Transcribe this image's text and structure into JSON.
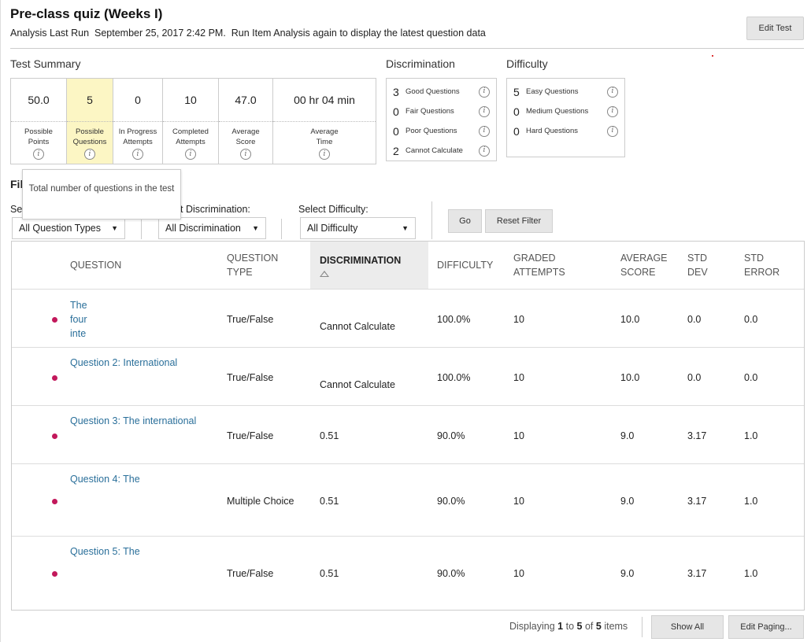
{
  "header": {
    "title": "Pre-class quiz (Weeks I)",
    "analysis_prefix": "Analysis Last Run",
    "analysis_date": "September 25, 2017 2:42 PM.",
    "analysis_suffix": "Run Item Analysis again to display the latest question data",
    "edit_test_label": "Edit Test"
  },
  "summary": {
    "label": "Test Summary",
    "items": [
      {
        "value": "50.0",
        "label1": "Possible",
        "label2": "Points"
      },
      {
        "value": "5",
        "label1": "Possible",
        "label2": "Questions"
      },
      {
        "value": "0",
        "label1": "In Progress",
        "label2": "Attempts"
      },
      {
        "value": "10",
        "label1": "Completed",
        "label2": "Attempts"
      },
      {
        "value": "47.0",
        "label1": "Average",
        "label2": "Score"
      },
      {
        "value": "00 hr 04 min",
        "label1": "Average",
        "label2": "Time"
      }
    ]
  },
  "discrimination": {
    "label": "Discrimination",
    "rows": [
      {
        "count": "3",
        "text": "Good Questions"
      },
      {
        "count": "0",
        "text": "Fair Questions"
      },
      {
        "count": "0",
        "text": "Poor Questions"
      },
      {
        "count": "2",
        "text": "Cannot Calculate"
      }
    ]
  },
  "difficulty": {
    "label": "Difficulty",
    "rows": [
      {
        "count": "5",
        "text": "Easy Questions"
      },
      {
        "count": "0",
        "text": "Medium Questions"
      },
      {
        "count": "0",
        "text": "Hard Questions"
      }
    ]
  },
  "tooltip": {
    "text": "Total number of questions in the test"
  },
  "filter": {
    "heading_partial": "Fil",
    "type_label_partial": "Se",
    "discrimination_label_partial": "t Discrimination:",
    "difficulty_label": "Select Difficulty:",
    "type_value": "All Question Types",
    "discrimination_value": "All Discrimination",
    "difficulty_value": "All Difficulty",
    "go_label": "Go",
    "reset_label": "Reset Filter"
  },
  "table": {
    "headers": {
      "question": "QUESTION",
      "type_1": "QUESTION",
      "type_2": "TYPE",
      "discrimination": "DISCRIMINATION",
      "difficulty": "DIFFICULTY",
      "graded_1": "GRADED",
      "graded_2": "ATTEMPTS",
      "avg_1": "AVERAGE",
      "avg_2": "SCORE",
      "std_dev_1": "STD",
      "std_dev_2": "DEV",
      "std_err_1": "STD",
      "std_err_2": "ERROR"
    },
    "rows": [
      {
        "q_lines": [
          "The",
          "four",
          "inte"
        ],
        "type": "True/False",
        "discrimination": "Cannot Calculate",
        "difficulty": "100.0%",
        "graded": "10",
        "avg": "10.0",
        "std_dev": "0.0",
        "std_err": "0.0"
      },
      {
        "q_lines": [
          "Question 2: International"
        ],
        "type": "True/False",
        "discrimination": "Cannot Calculate",
        "difficulty": "100.0%",
        "graded": "10",
        "avg": "10.0",
        "std_dev": "0.0",
        "std_err": "0.0"
      },
      {
        "q_lines": [
          "Question 3: The international"
        ],
        "type": "True/False",
        "discrimination": "0.51",
        "difficulty": "90.0%",
        "graded": "10",
        "avg": "9.0",
        "std_dev": "3.17",
        "std_err": "1.0"
      },
      {
        "q_lines": [
          "Question 4: The"
        ],
        "type": "Multiple Choice",
        "discrimination": "0.51",
        "difficulty": "90.0%",
        "graded": "10",
        "avg": "9.0",
        "std_dev": "3.17",
        "std_err": "1.0"
      },
      {
        "q_lines": [
          "Question 5: The"
        ],
        "type": "True/False",
        "discrimination": "0.51",
        "difficulty": "90.0%",
        "graded": "10",
        "avg": "9.0",
        "std_dev": "3.17",
        "std_err": "1.0"
      }
    ]
  },
  "paging": {
    "displaying": "Displaying",
    "from": "1",
    "to_word": "to",
    "to": "5",
    "of_word": "of",
    "total": "5",
    "items_word": "items",
    "show_all_label": "Show All",
    "edit_paging_label": "Edit Paging..."
  }
}
